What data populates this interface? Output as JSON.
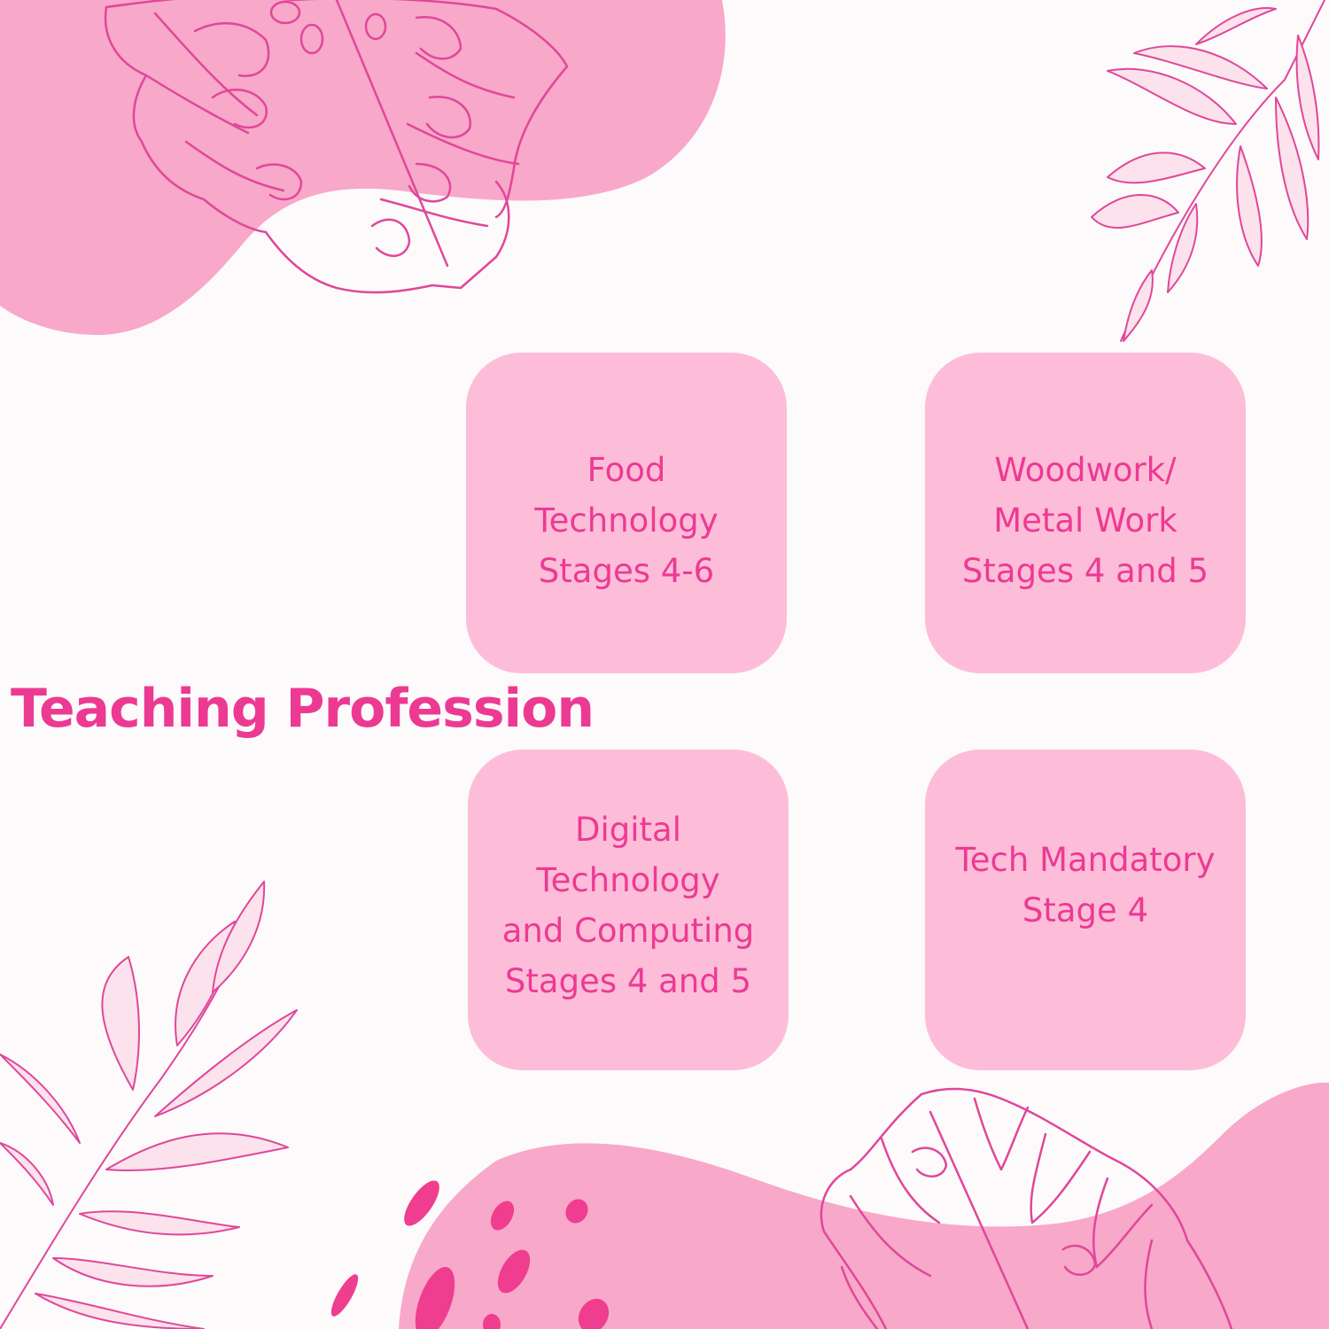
{
  "title": "Teaching Profession",
  "colors": {
    "background": "#fdfafb",
    "blob": "#f8a8c8",
    "card": "#fdbdd8",
    "text": "#ec3a93",
    "leaf_line": "#e0479a",
    "dots": "#ef3d8f"
  },
  "cards": [
    {
      "lines": [
        "Food",
        "Technology",
        "Stages 4-6"
      ]
    },
    {
      "lines": [
        "Woodwork/",
        "Metal Work",
        "Stages 4 and 5"
      ]
    },
    {
      "lines": [
        "Digital",
        "Technology",
        "and Computing",
        "Stages 4 and 5"
      ]
    },
    {
      "lines": [
        "Tech Mandatory",
        "Stage 4"
      ]
    }
  ],
  "decorations": [
    "monstera-leaf-icon",
    "palm-frond-icon",
    "paint-dots-icon"
  ]
}
